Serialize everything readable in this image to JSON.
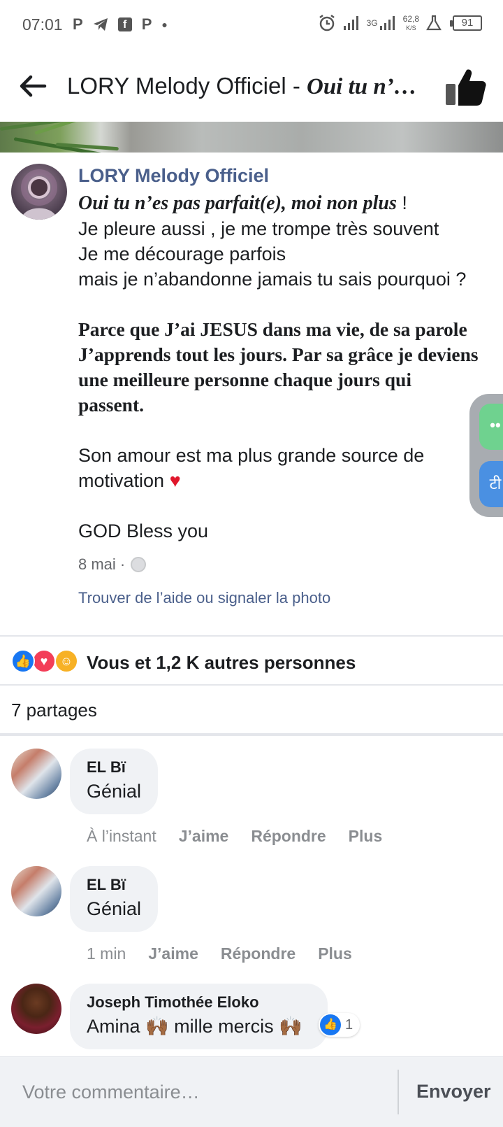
{
  "status_bar": {
    "time": "07:01",
    "left_icons": [
      "parking-icon",
      "telegram-icon",
      "facebook-icon",
      "parking-icon",
      "dot-icon"
    ],
    "network_speed_value": "62,8",
    "network_speed_unit": "K/S",
    "network_type": "3G",
    "battery": "91"
  },
  "header": {
    "title_plain": "LORY Melody Officiel - ",
    "title_italic": "Oui tu n’…"
  },
  "post": {
    "author": "LORY Melody Officiel",
    "line1_italic": "Oui tu n’es pas parfait(e), moi non plus",
    "line1_end": " !",
    "line2": "Je pleure aussi , je me trompe très souvent",
    "line3": "Je me décourage parfois",
    "line4": "mais je n’abandonne jamais tu sais pourquoi ?",
    "bold_line1": "Parce que J’ai JESUS dans ma vie, de sa parole",
    "bold_line2": "J’apprends tout les jours. Par sa grâce je deviens",
    "bold_line3": "une meilleure personne chaque jours qui",
    "bold_line4": "passent.",
    "line5": "Son amour est ma plus grande source de",
    "line6": "motivation",
    "heart_emoji": "♥",
    "line7": "GOD Bless you",
    "date": "8 mai ·",
    "report_link": "Trouver de l’aide ou signaler la photo"
  },
  "side_widget": {
    "top_label": "••",
    "bottom_label": "टी"
  },
  "reactions": {
    "icons": [
      "like-icon",
      "love-icon",
      "care-icon"
    ],
    "text": "Vous et 1,2 K autres personnes"
  },
  "shares": {
    "text": "7 partages"
  },
  "comments": [
    {
      "name": "EL Bï",
      "text": "Génial",
      "time": "À l’instant",
      "like": "J’aime",
      "reply": "Répondre",
      "more": "Plus"
    },
    {
      "name": "EL Bï",
      "text": "Génial",
      "time": "1 min",
      "like": "J’aime",
      "reply": "Répondre",
      "more": "Plus"
    },
    {
      "name": "Joseph Timothée Eloko",
      "text": "Amina 🙌🏾 mille mercis 🙌🏾",
      "like_count": "1"
    }
  ],
  "composer": {
    "placeholder": "Votre commentaire…",
    "send_label": "Envoyer"
  },
  "colors": {
    "link_blue": "#4a5f8b",
    "fb_blue": "#1877f2",
    "bubble_bg": "#f0f2f5",
    "muted": "#8a8d91"
  }
}
